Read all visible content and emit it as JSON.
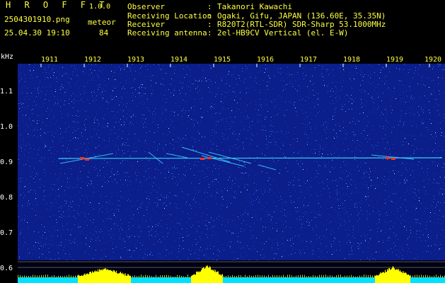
{
  "app": {
    "name": "H R O F F T",
    "version": "1.0.0"
  },
  "file": {
    "name": "2504301910.png",
    "datetime": "25.04.30 19:10",
    "mode": "meteor",
    "count": "84"
  },
  "station": [
    {
      "label": "Observer",
      "value": "Takanori Kawachi"
    },
    {
      "label": "Receiving Location",
      "value": "Ogaki, Gifu, JAPAN (136.60E, 35.35N)"
    },
    {
      "label": "Receiver",
      "value": "R820T2(RTL-SDR) SDR-Sharp 53.1000MHz"
    },
    {
      "label": "Receiving antenna",
      "value": "2el-HB9CV Vertical (el. E-W)"
    }
  ],
  "axes": {
    "y_unit": "kHz",
    "y_ticks": [
      "1.1",
      "1.0",
      "0.9",
      "0.8",
      "0.7",
      "0.6"
    ],
    "x_ticks": [
      "1911",
      "1912",
      "1913",
      "1914",
      "1915",
      "1916",
      "1917",
      "1918",
      "1919",
      "1920"
    ]
  },
  "colors": {
    "header_text": "#ffff40",
    "axis_text": "#ffffff",
    "noise_bg": "#0b1e8a",
    "signal": "#40e0ff",
    "peak": "#ff3020",
    "bar": "#ffff00"
  }
}
